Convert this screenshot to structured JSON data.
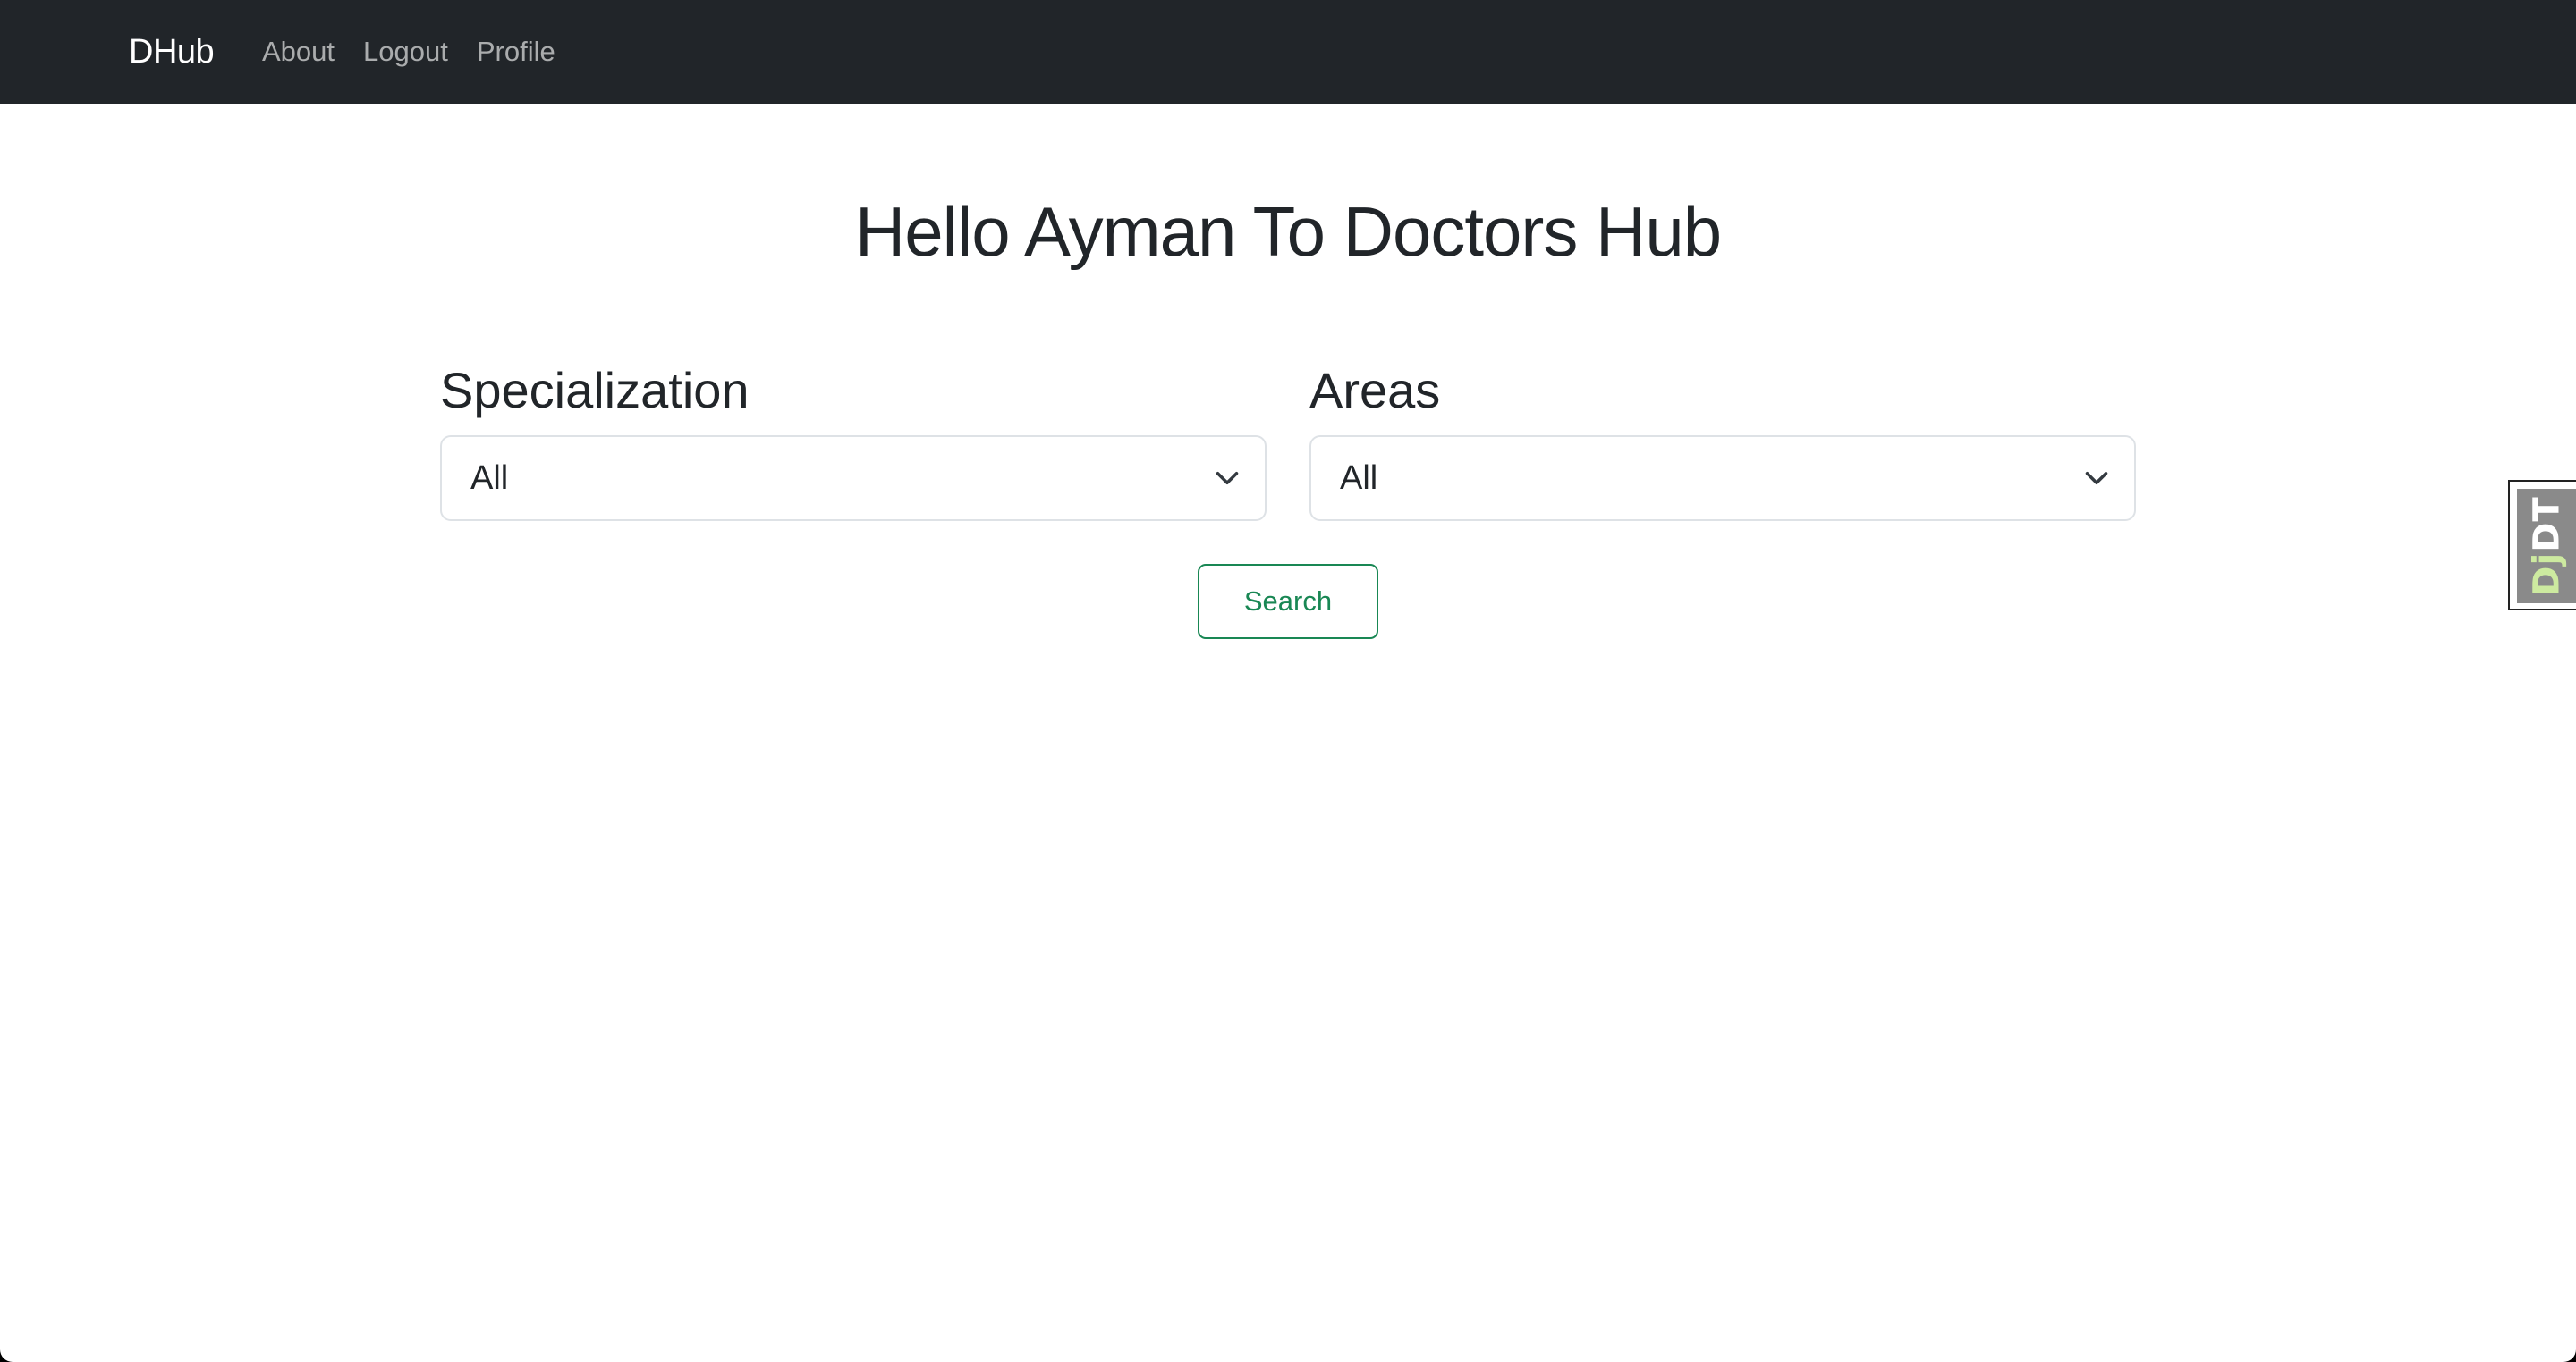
{
  "navbar": {
    "brand": "DHub",
    "links": [
      {
        "label": "About"
      },
      {
        "label": "Logout"
      },
      {
        "label": "Profile"
      }
    ]
  },
  "main": {
    "title": "Hello Ayman To Doctors Hub",
    "filters": {
      "specialization": {
        "label": "Specialization",
        "selected": "All"
      },
      "areas": {
        "label": "Areas",
        "selected": "All"
      }
    },
    "search_label": "Search"
  },
  "debug_toolbar": {
    "handle_prefix": "Dj",
    "handle_suffix": "DT"
  },
  "colors": {
    "navbar_bg": "#212529",
    "accent_success": "#198754",
    "text": "#212529"
  },
  "icons": {
    "select_arrow": "chevron-down-icon"
  }
}
